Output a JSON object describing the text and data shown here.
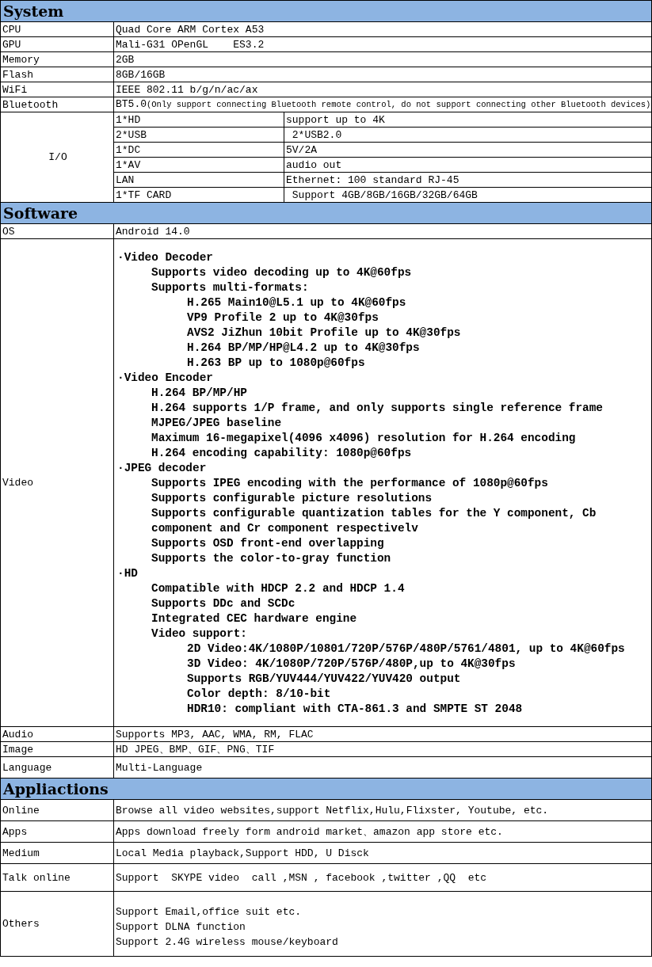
{
  "sections": [
    {
      "title": "System",
      "rows": [
        {
          "kind": "text",
          "label": "CPU",
          "value": "Quad Core ARM Cortex A53"
        },
        {
          "kind": "text",
          "label": "GPU",
          "value": "Mali-G31 OPenGL    ES3.2"
        },
        {
          "kind": "text",
          "label": "Memory",
          "value": "2GB"
        },
        {
          "kind": "text",
          "label": "Flash",
          "value": "8GB/16GB"
        },
        {
          "kind": "text",
          "label": "WiFi",
          "value": "IEEE 802.11 b/g/n/ac/ax"
        },
        {
          "kind": "note",
          "label": "Bluetooth",
          "value": "BT5.0",
          "note": "(Only support connecting Bluetooth remote control, do not support connecting other Bluetooth devices)"
        },
        {
          "kind": "ports",
          "label": "I/O",
          "ports": [
            {
              "port": "1*HD",
              "detail": "support up to 4K"
            },
            {
              "port": "2*USB",
              "detail": " 2*USB2.0"
            },
            {
              "port": "1*DC",
              "detail": "5V/2A"
            },
            {
              "port": "1*AV",
              "detail": "audio out"
            },
            {
              "port": "LAN",
              "detail": "Ethernet: 100 standard RJ-45"
            },
            {
              "port": "1*TF CARD",
              "detail": " Support 4GB/8GB/16GB/32GB/64GB"
            }
          ]
        }
      ]
    },
    {
      "title": "Software",
      "rows": [
        {
          "kind": "text",
          "label": "OS",
          "value": "Android 14.0"
        },
        {
          "kind": "outline",
          "label": "Video",
          "items": [
            {
              "text": "·Video Decoder",
              "children": [
                {
                  "text": "Supports video decoding up to 4K@60fps"
                },
                {
                  "text": "Supports multi-formats:",
                  "children": [
                    {
                      "text": "H.265 Main10@L5.1 up to 4K@60fps"
                    },
                    {
                      "text": "VP9 Profile 2 up to 4K@30fps"
                    },
                    {
                      "text": "AVS2 JiZhun 10bit Profile up to 4K@30fps"
                    },
                    {
                      "text": "H.264 BP/MP/HP@L4.2 up to 4K@30fps"
                    },
                    {
                      "text": "H.263 BP up to 1080p@60fps"
                    }
                  ]
                }
              ]
            },
            {
              "text": "·Video Encoder",
              "children": [
                {
                  "text": "H.264 BP/MP/HP"
                },
                {
                  "text": "H.264 supports 1/P frame, and only supports single reference frame"
                },
                {
                  "text": "MJPEG/JPEG baseline"
                },
                {
                  "text": "Maximum 16-megapixel(4096 x4096) resolution for H.264 encoding"
                },
                {
                  "text": "H.264 encoding capability: 1080p@60fps"
                }
              ]
            },
            {
              "text": "·JPEG decoder",
              "children": [
                {
                  "text": "Supports IPEG encoding with the performance of 1080p@60fps"
                },
                {
                  "text": "Supports configurable picture resolutions"
                },
                {
                  "text": "Supports configurable quantization tables for the Y component, Cb"
                },
                {
                  "text": "component and Cr component respectivelv"
                },
                {
                  "text": "Supports OSD front-end overlapping"
                },
                {
                  "text": "Supports the color-to-gray function"
                }
              ]
            },
            {
              "text": "·HD",
              "children": [
                {
                  "text": "Compatible with HDCP 2.2 and HDCP 1.4"
                },
                {
                  "text": "Supports DDc and SCDc"
                },
                {
                  "text": "Integrated CEC hardware engine"
                },
                {
                  "text": "Video support:",
                  "children": [
                    {
                      "text": "2D Video:4K/1080P/10801/720P/576P/480P/5761/4801, up to 4K@60fps"
                    },
                    {
                      "text": "3D Video: 4K/1080P/720P/576P/480P,up to 4K@30fps"
                    },
                    {
                      "text": "Supports RGB/YUV444/YUV422/YUV420 output"
                    },
                    {
                      "text": "Color depth: 8/10-bit"
                    },
                    {
                      "text": "HDR10: compliant with CTA-861.3 and SMPTE ST 2048"
                    }
                  ]
                }
              ]
            }
          ]
        },
        {
          "kind": "text",
          "label": "Audio",
          "value": "Supports MP3, AAC, WMA, RM, FLAC"
        },
        {
          "kind": "text",
          "label": "Image",
          "value": "HD JPEG、BMP、GIF、PNG、TIF"
        },
        {
          "kind": "text",
          "label": "Language",
          "value": "Multi-Language"
        }
      ]
    },
    {
      "title": "Appliactions",
      "rows": [
        {
          "kind": "text",
          "label": "Online",
          "value": "Browse all video websites,support Netflix,Hulu,Flixster, Youtube, etc."
        },
        {
          "kind": "text",
          "label": "Apps",
          "value": "Apps download freely form android market、amazon app store etc."
        },
        {
          "kind": "text",
          "label": "Medium",
          "value": "Local Media playback,Support HDD, U Disck"
        },
        {
          "kind": "text",
          "label": "Talk online",
          "value": "Support  SKYPE video  call ,MSN , facebook ,twitter ,QQ  etc"
        },
        {
          "kind": "lines",
          "label": "Others",
          "lines": [
            "Support Email,office suit etc.",
            "Support DLNA function",
            "Support 2.4G wireless mouse/keyboard"
          ]
        }
      ]
    }
  ]
}
